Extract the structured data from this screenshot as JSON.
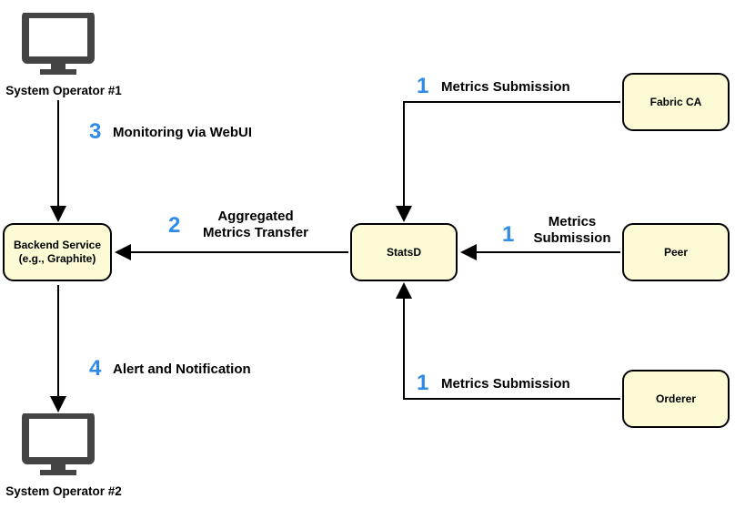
{
  "operators": {
    "top": {
      "caption": "System Operator #1"
    },
    "bottom": {
      "caption": "System Operator #2"
    }
  },
  "nodes": {
    "backend": {
      "label": "Backend Service\n(e.g., Graphite)"
    },
    "statsd": {
      "label": "StatsD"
    },
    "fabricca": {
      "label": "Fabric CA"
    },
    "peer": {
      "label": "Peer"
    },
    "orderer": {
      "label": "Orderer"
    }
  },
  "steps": {
    "s1a": {
      "num": "1",
      "label": "Metrics Submission"
    },
    "s1b": {
      "num": "1",
      "label": "Metrics\nSubmission"
    },
    "s1c": {
      "num": "1",
      "label": "Metrics Submission"
    },
    "s2": {
      "num": "2",
      "label": "Aggregated\nMetrics Transfer"
    },
    "s3": {
      "num": "3",
      "label": "Monitoring via WebUI"
    },
    "s4": {
      "num": "4",
      "label": "Alert and Notification"
    }
  }
}
